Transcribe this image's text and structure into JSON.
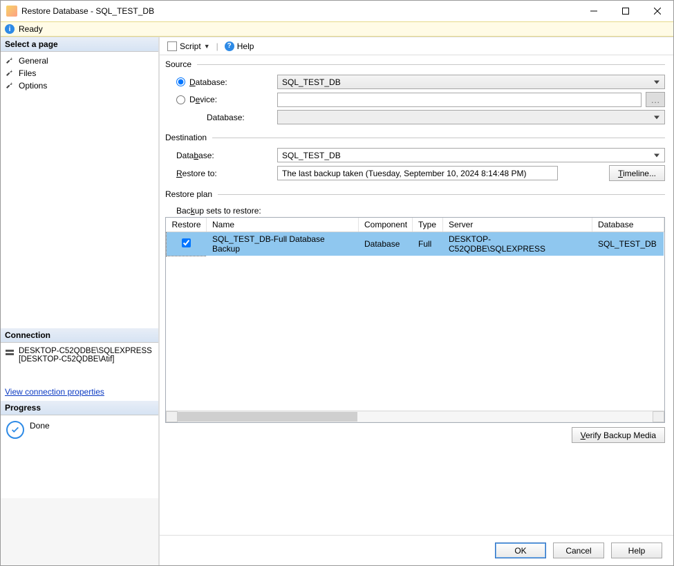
{
  "window": {
    "title": "Restore Database - SQL_TEST_DB"
  },
  "status": {
    "text": "Ready"
  },
  "left": {
    "select_page_header": "Select a page",
    "pages": [
      "General",
      "Files",
      "Options"
    ],
    "connection_header": "Connection",
    "connection_value": "DESKTOP-C52QDBE\\SQLEXPRESS [DESKTOP-C52QDBE\\Atif]",
    "view_props_link": "View connection properties",
    "progress_header": "Progress",
    "progress_text": "Done"
  },
  "toolbar": {
    "script_label": "Script",
    "help_label": "Help"
  },
  "source": {
    "legend": "Source",
    "database_radio_label": "Database:",
    "database_value": "SQL_TEST_DB",
    "device_radio_label": "Device:",
    "device_browse": "…",
    "device_db_label": "Database:",
    "device_db_value": ""
  },
  "destination": {
    "legend": "Destination",
    "database_label": "Database:",
    "database_value": "SQL_TEST_DB",
    "restore_to_label": "Restore to:",
    "restore_to_value": "The last backup taken (Tuesday, September 10, 2024 8:14:48 PM)",
    "timeline_button": "Timeline..."
  },
  "plan": {
    "legend": "Restore plan",
    "backup_sets_label": "Backup sets to restore:",
    "columns": {
      "c0": "Restore",
      "c1": "Name",
      "c2": "Component",
      "c3": "Type",
      "c4": "Server",
      "c5": "Database"
    },
    "rows": [
      {
        "restore": true,
        "name": "SQL_TEST_DB-Full Database Backup",
        "component": "Database",
        "type": "Full",
        "server": "DESKTOP-C52QDBE\\SQLEXPRESS",
        "database": "SQL_TEST_DB"
      }
    ],
    "verify_button": "Verify Backup Media"
  },
  "footer": {
    "ok": "OK",
    "cancel": "Cancel",
    "help": "Help"
  }
}
